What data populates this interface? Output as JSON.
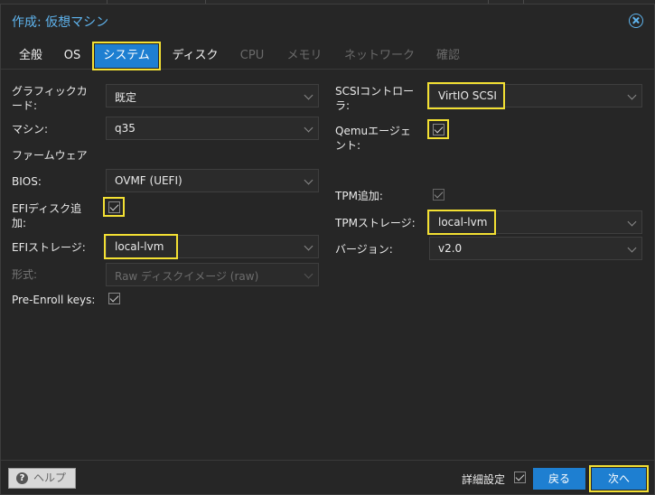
{
  "window": {
    "title": "作成: 仮想マシン"
  },
  "tabs": [
    {
      "label": "全般",
      "state": "enabled"
    },
    {
      "label": "OS",
      "state": "enabled"
    },
    {
      "label": "システム",
      "state": "active"
    },
    {
      "label": "ディスク",
      "state": "enabled"
    },
    {
      "label": "CPU",
      "state": "disabled"
    },
    {
      "label": "メモリ",
      "state": "disabled"
    },
    {
      "label": "ネットワーク",
      "state": "disabled"
    },
    {
      "label": "確認",
      "state": "disabled"
    }
  ],
  "left": {
    "graphic_card": {
      "label_line1": "グラフィックカ",
      "label_line2": "ード:",
      "value": "既定"
    },
    "machine": {
      "label": "マシン:",
      "value": "q35"
    },
    "firmware_section": "ファームウェア",
    "bios": {
      "label": "BIOS:",
      "value": "OVMF (UEFI)"
    },
    "efi_disk": {
      "label_line1": "EFIディスク追",
      "label_line2": "加:",
      "checked": true
    },
    "efi_storage": {
      "label": "EFIストレージ:",
      "value": "local-lvm"
    },
    "format": {
      "label": "形式:",
      "value": "Raw ディスクイメージ (raw)"
    },
    "pre_enroll": {
      "label": "Pre-Enroll keys:",
      "checked": true
    }
  },
  "right": {
    "scsi_controller": {
      "label_line1": "SCSIコントロー",
      "label_line2": "ラ:",
      "value": "VirtIO SCSI"
    },
    "qemu_agent": {
      "label_line1": "Qemuエージェ",
      "label_line2": "ント:",
      "checked": true
    },
    "tpm_add": {
      "label": "TPM追加:",
      "checked": true
    },
    "tpm_storage": {
      "label": "TPMストレージ:",
      "value": "local-lvm"
    },
    "version": {
      "label": "バージョン:",
      "value": "v2.0"
    }
  },
  "footer": {
    "help": "ヘルプ",
    "advanced": "詳細設定",
    "advanced_checked": true,
    "back": "戻る",
    "next": "次へ"
  },
  "colors": {
    "accent": "#1e7fd1",
    "title": "#5fb4ee",
    "highlight": "#f3e033"
  }
}
